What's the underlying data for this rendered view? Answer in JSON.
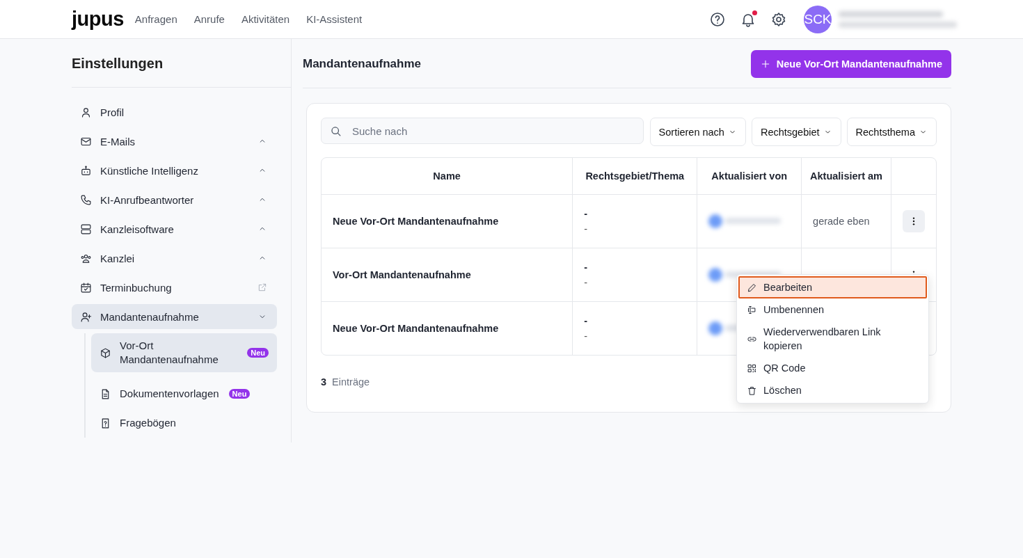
{
  "header": {
    "logo": "jupus",
    "nav": [
      {
        "label": "Anfragen",
        "selected": false
      },
      {
        "label": "Anrufe",
        "selected": false
      },
      {
        "label": "Aktivitäten",
        "selected": false
      },
      {
        "label": "KI-Assistent",
        "selected": false
      }
    ],
    "notifications_unread": true,
    "avatar": "SCK"
  },
  "sidebar": {
    "title": "Einstellungen",
    "items": [
      {
        "label": "Profil",
        "selected": false
      },
      {
        "label": "E-Mails",
        "expanded": false,
        "selected": false
      },
      {
        "label": "Künstliche Intelligenz",
        "expanded": false,
        "selected": false
      },
      {
        "label": "KI-Anrufbeantworter",
        "expanded": false,
        "selected": false
      },
      {
        "label": "Kanzleisoftware",
        "expanded": false,
        "selected": false
      },
      {
        "label": "Kanzlei",
        "expanded": false,
        "selected": false
      },
      {
        "label": "Terminbuchung",
        "selected": false
      },
      {
        "label": "Mandantenaufnahme",
        "expanded": true,
        "selected": true,
        "children": [
          {
            "label": "Vor-Ort Mandantenaufnahme",
            "badge": "Neu",
            "selected": true
          },
          {
            "label": "Dokumentenvorlagen",
            "badge": "Neu",
            "selected": false
          },
          {
            "label": "Fragebögen",
            "selected": false
          }
        ]
      }
    ]
  },
  "main": {
    "title": "Mandantenaufnahme",
    "primary_button": "Neue Vor-Ort Mandantenaufnahme",
    "search": {
      "placeholder": "Suche nach"
    },
    "filters": [
      "Sortieren nach",
      "Rechtsgebiet",
      "Rechtsthema"
    ],
    "table": {
      "columns": [
        "Name",
        "Rechtsgebiet/Thema",
        "Aktualisiert von",
        "Aktualisiert am"
      ],
      "rows": [
        {
          "name": "Neue Vor-Ort Mandantenaufnahme",
          "area": "-",
          "topic": "-",
          "updated_at": "gerade eben"
        },
        {
          "name": "Vor-Ort Mandantenaufnahme",
          "area": "-",
          "topic": "-"
        },
        {
          "name": "Neue Vor-Ort Mandantenaufnahme",
          "area": "-",
          "topic": "-"
        }
      ]
    },
    "footer": {
      "count": "3",
      "label": "Einträge"
    },
    "menu": [
      {
        "label": "Bearbeiten",
        "selected": true
      },
      {
        "label": "Umbenennen",
        "selected": false
      },
      {
        "label": "Wiederverwendbaren Link kopieren",
        "selected": false
      },
      {
        "label": "QR Code",
        "selected": false
      },
      {
        "label": "Löschen",
        "selected": false
      }
    ]
  }
}
